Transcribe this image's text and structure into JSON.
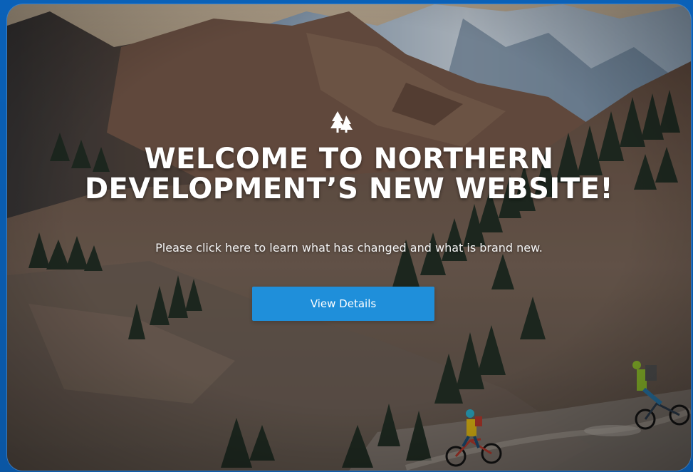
{
  "modal": {
    "headline_line1": "WELCOME TO NORTHERN",
    "headline_line2": "DEVELOPMENT’S NEW WEBSITE!",
    "subtext": "Please click here to learn what has changed and what is brand new.",
    "button_label": "View Details",
    "icon": "trees-icon"
  },
  "colors": {
    "page_blue": "#0b5aa8",
    "button_blue": "#1f8fda"
  }
}
